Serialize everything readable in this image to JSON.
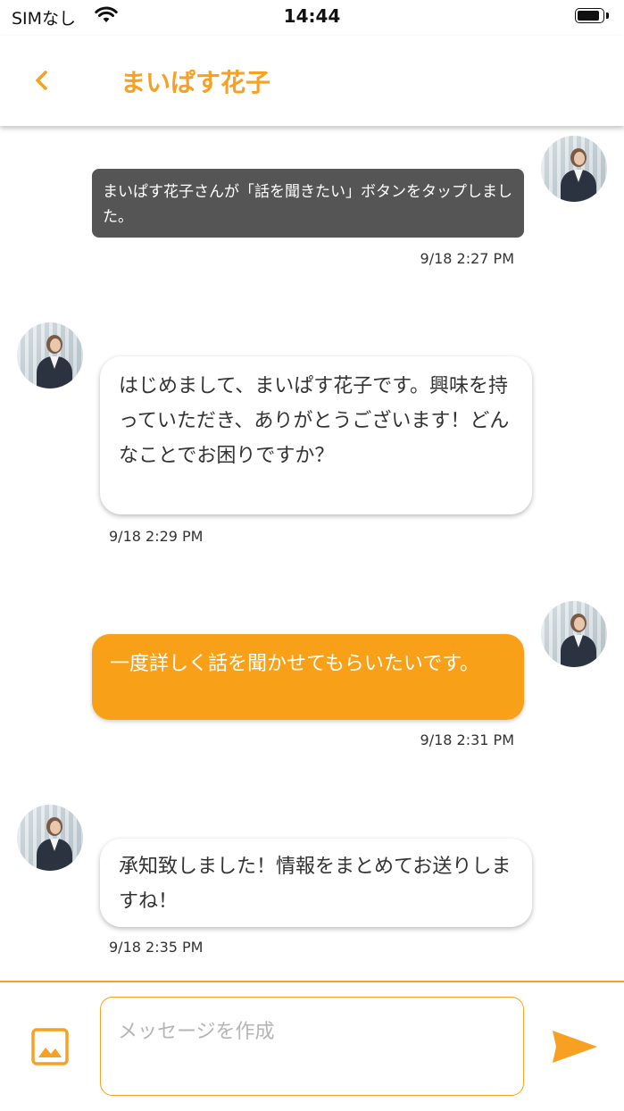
{
  "status_bar": {
    "carrier": "SIMなし",
    "time": "14:44",
    "wifi_icon": "wifi-icon",
    "battery_icon": "battery-icon"
  },
  "header": {
    "back_icon": "chevron-left-icon",
    "title": "まいぱす花子"
  },
  "messages": [
    {
      "type": "system",
      "text": "まいぱす花子さんが「話を聞きたい」ボタンをタップしました。",
      "time": "9/18 2:27 PM"
    },
    {
      "type": "incoming",
      "text": "はじめまして、まいぱす花子です。興味を持っていただき、ありがとうございます！どんなことでお困りですか？",
      "time": "9/18 2:29 PM"
    },
    {
      "type": "outgoing",
      "text": "一度詳しく話を聞かせてもらいたいです。",
      "time": "9/18 2:31 PM"
    },
    {
      "type": "incoming",
      "text": "承知致しました！情報をまとめてお送りしますね！",
      "time": "9/18 2:35 PM"
    }
  ],
  "composer": {
    "placeholder": "メッセージを作成",
    "image_icon": "image-icon",
    "send_icon": "send-icon"
  },
  "colors": {
    "accent": "#F7A021",
    "system_bubble": "#555555",
    "outgoing_bubble": "#F7A018"
  }
}
